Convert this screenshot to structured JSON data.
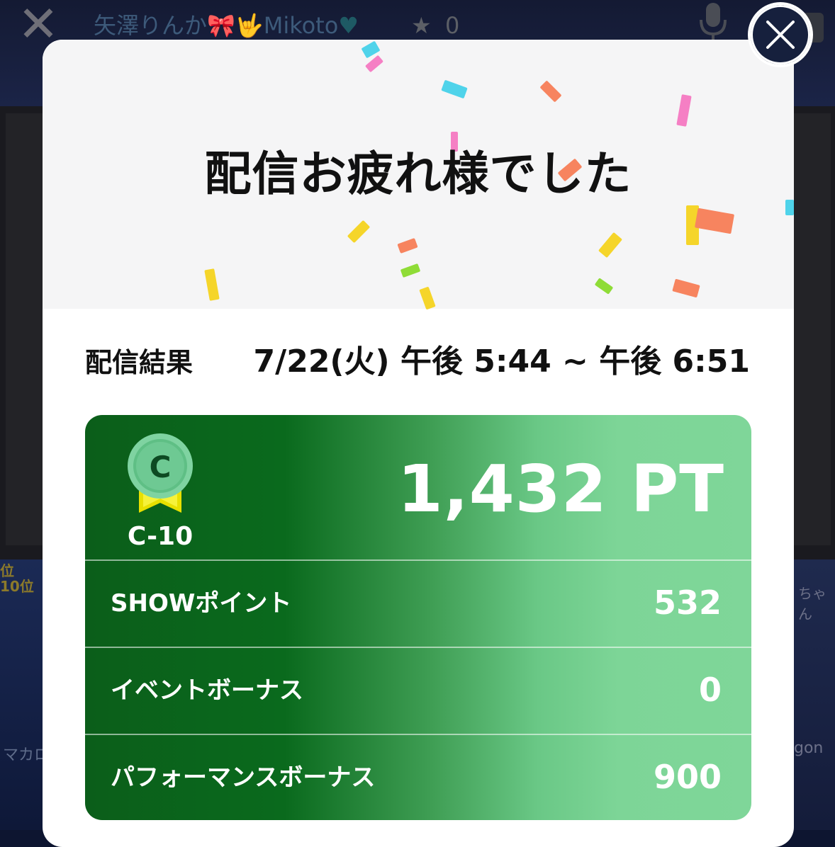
{
  "background": {
    "stream_title": "矢澤りんか",
    "stream_title_suffix": "Mikoto",
    "star_count": "0",
    "left_rank_text": "位\n10位",
    "left_bottom_text": "マカロ",
    "right_bottom_text": "gon",
    "right_top_text": "ちゃん"
  },
  "modal": {
    "title": "配信お疲れ様でした",
    "result_label": "配信結果",
    "result_time": "7/22(火) 午後 5:44 ~ 午後 6:51"
  },
  "score_card": {
    "rank_badge": "C",
    "rank_label": "C-10",
    "total_points": "1,432 PT",
    "rows": [
      {
        "label": "SHOWポイント",
        "value": "532"
      },
      {
        "label": "イベントボーナス",
        "value": "0"
      },
      {
        "label": "パフォーマンスボーナス",
        "value": "900"
      }
    ]
  },
  "colors": {
    "card_dark_green": "#0a6a1d",
    "card_light_green": "#7fd699",
    "close_button_bg": "#16203d"
  },
  "icons": [
    "close-icon",
    "microphone-icon",
    "star-icon",
    "rank-medal-icon"
  ]
}
